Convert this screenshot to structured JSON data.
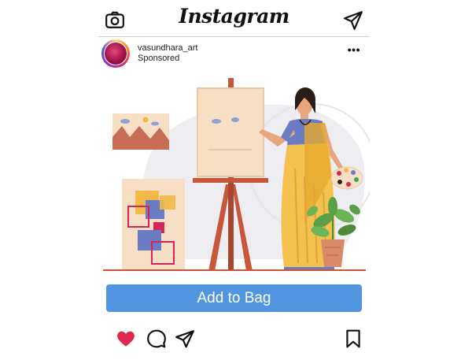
{
  "topbar": {
    "logo_text": "Instagram",
    "left_icon": "camera-icon",
    "right_icon": "send-icon"
  },
  "post": {
    "username": "vasundhara_art",
    "label": "Sponsored",
    "more_icon": "more-options-icon",
    "more_text": "•••",
    "image_subject": "illustration",
    "cta_label": "Add to Bag"
  },
  "actions": {
    "like_icon": "heart-icon",
    "like_active": true,
    "comment_icon": "comment-icon",
    "share_icon": "share-icon",
    "save_icon": "bookmark-icon"
  },
  "colors": {
    "cta": "#5195e0",
    "like": "#e0284e",
    "saree": "#f2c14e",
    "easel": "#c8573a"
  }
}
